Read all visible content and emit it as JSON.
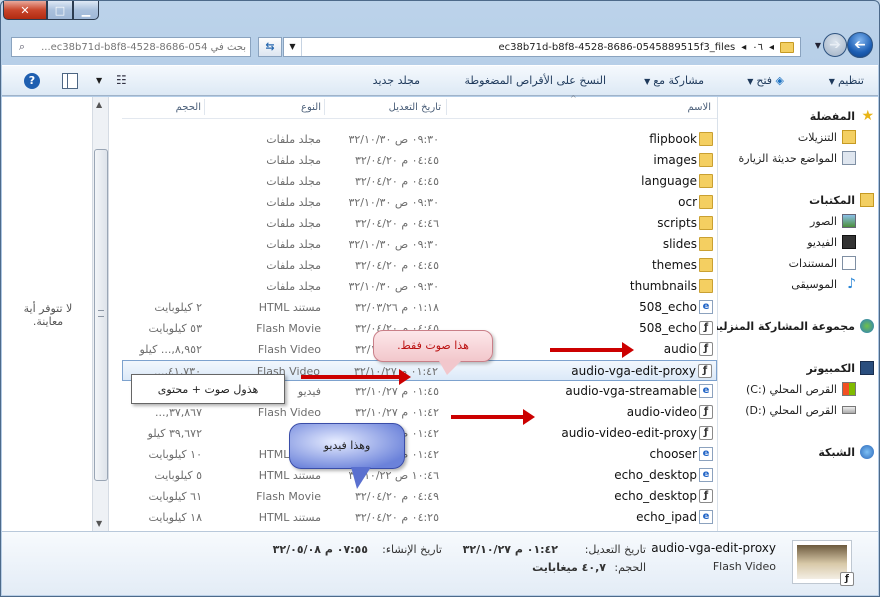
{
  "window": {
    "close_symbol": "✕",
    "max_symbol": "□",
    "min_symbol": "▁"
  },
  "search": {
    "placeholder": "بحث في ec38b71d-b8f8-4528-8686-054..."
  },
  "address": {
    "crumbs": [
      "ec38b71d-b8f8-4528-8686-0545889515f3_files",
      "٠٦"
    ]
  },
  "toolbar": {
    "organize": "تنظيم",
    "open": "فتح",
    "share": "مشاركة مع",
    "burn": "النسخ على الأقراص المضغوطة",
    "new_folder": "مجلد جديد"
  },
  "nav_pane": {
    "favorites": "المفضلة",
    "downloads": "التنزيلات",
    "recent": "المواضع حديثة الزيارة",
    "libraries": "المكتبات",
    "pictures": "الصور",
    "videos": "الفيديو",
    "documents": "المستندات",
    "music": "الموسيقى",
    "homegroup": "مجموعة المشاركة المنزلية",
    "computer": "الكمبيوتر",
    "drive_c": "القرص المحلي (:C)",
    "drive_d": "القرص المحلي (:D)",
    "network": "الشبكة"
  },
  "columns": {
    "name": "الاسم",
    "date": "تاريخ التعديل",
    "type": "النوع",
    "size": "الحجم"
  },
  "files": [
    {
      "name": "flipbook",
      "date": "٠٩:٣٠ ص ٣٢/١٠/٣٠",
      "type": "مجلد ملفات",
      "size": "",
      "icon": "folder"
    },
    {
      "name": "images",
      "date": "٠٤:٤٥ م ٣٢/٠٤/٢٠",
      "type": "مجلد ملفات",
      "size": "",
      "icon": "folder"
    },
    {
      "name": "language",
      "date": "٠٤:٤٥ م ٣٢/٠٤/٢٠",
      "type": "مجلد ملفات",
      "size": "",
      "icon": "folder"
    },
    {
      "name": "ocr",
      "date": "٠٩:٣٠ ص ٣٢/١٠/٣٠",
      "type": "مجلد ملفات",
      "size": "",
      "icon": "folder"
    },
    {
      "name": "scripts",
      "date": "٠٤:٤٦ م ٣٢/٠٤/٢٠",
      "type": "مجلد ملفات",
      "size": "",
      "icon": "folder"
    },
    {
      "name": "slides",
      "date": "٠٩:٣٠ ص ٣٢/١٠/٣٠",
      "type": "مجلد ملفات",
      "size": "",
      "icon": "folder"
    },
    {
      "name": "themes",
      "date": "٠٤:٤٥ م ٣٢/٠٤/٢٠",
      "type": "مجلد ملفات",
      "size": "",
      "icon": "folder"
    },
    {
      "name": "thumbnails",
      "date": "٠٩:٣٠ ص ٣٢/١٠/٣٠",
      "type": "مجلد ملفات",
      "size": "",
      "icon": "folder"
    },
    {
      "name": "508_echo",
      "date": "٠١:١٨ م ٣٢/٠٣/٢٦",
      "type": "مستند HTML",
      "size": "٢ كيلوبايت",
      "icon": "html"
    },
    {
      "name": "508_echo",
      "date": "٠٤:٤٥ م ٣٢/٠٤/٢٠",
      "type": "Flash Movie",
      "size": "٥٣ كيلوبايت",
      "icon": "flash"
    },
    {
      "name": "audio",
      "date": "٠١:٤٢ م ٣٢/١٠/٢٧",
      "type": "Flash Video",
      "size": "٨,٩٥٢,... كيلو",
      "icon": "flash"
    },
    {
      "name": "audio-vga-edit-proxy",
      "date": "٠١:٤٢ م ٣٢/١٠/٢٧",
      "type": "Flash Video",
      "size": "٤١,٧٣٠,...",
      "icon": "flash"
    },
    {
      "name": "audio-vga-streamable",
      "date": "٠١:٤٥ م ٣٢/١٠/٢٧",
      "type": "فيديو",
      "size": "",
      "icon": "html"
    },
    {
      "name": "audio-video",
      "date": "٠١:٤٢ م ٣٢/١٠/٢٧",
      "type": "Flash Video",
      "size": "٣٧,٨٦٧,...",
      "icon": "flash"
    },
    {
      "name": "audio-video-edit-proxy",
      "date": "٠١:٤٢ م ٣٢/١٠/٢٧",
      "type": "Flash",
      "size": "٣٩,٦٧٢ كيلو",
      "icon": "flash"
    },
    {
      "name": "chooser",
      "date": "٠١:٤٢ م ٣٢/١٠/٢٧",
      "type": "مستند HTML",
      "size": "١٠ كيلوبايت",
      "icon": "html"
    },
    {
      "name": "echo_desktop",
      "date": "١٠:٤٦ ص ٣٢/١٠/٢٢",
      "type": "مستند HTML",
      "size": "٥ كيلوبايت",
      "icon": "html"
    },
    {
      "name": "echo_desktop",
      "date": "٠٤:٤٩ م ٣٢/٠٤/٢٠",
      "type": "Flash Movie",
      "size": "٦١ كيلوبايت",
      "icon": "flash"
    },
    {
      "name": "echo_ipad",
      "date": "٠٤:٢٥ م ٣٢/٠٤/٢٠",
      "type": "مستند HTML",
      "size": "١٨ كيلوبايت",
      "icon": "html"
    }
  ],
  "preview_pane": {
    "message": "لا تتوفر أية معاينة."
  },
  "details": {
    "filename": "audio-vga-edit-proxy",
    "filetype": "Flash Video",
    "modified_label": "تاريخ التعديل:",
    "modified_value": "٠١:٤٢ م ٣٢/١٠/٢٧",
    "created_label": "تاريخ الإنشاء:",
    "created_value": "٠٧:٥٥ م ٣٢/٠٥/٠٨",
    "size_label": "الحجم:",
    "size_value": "٤٠,٧ ميغابايت"
  },
  "annotations": {
    "audio_only": "هذا صوت فقط.",
    "audio_plus_content": "هذول صوت + محتوى",
    "this_video": "وهذا فيديو"
  },
  "colors": {
    "accent": "#1e395b",
    "arrow": "#cc0000",
    "selection": "#7da2ce",
    "callout_pink": "#f6d6d8",
    "callout_blue": "#5a70cf"
  }
}
